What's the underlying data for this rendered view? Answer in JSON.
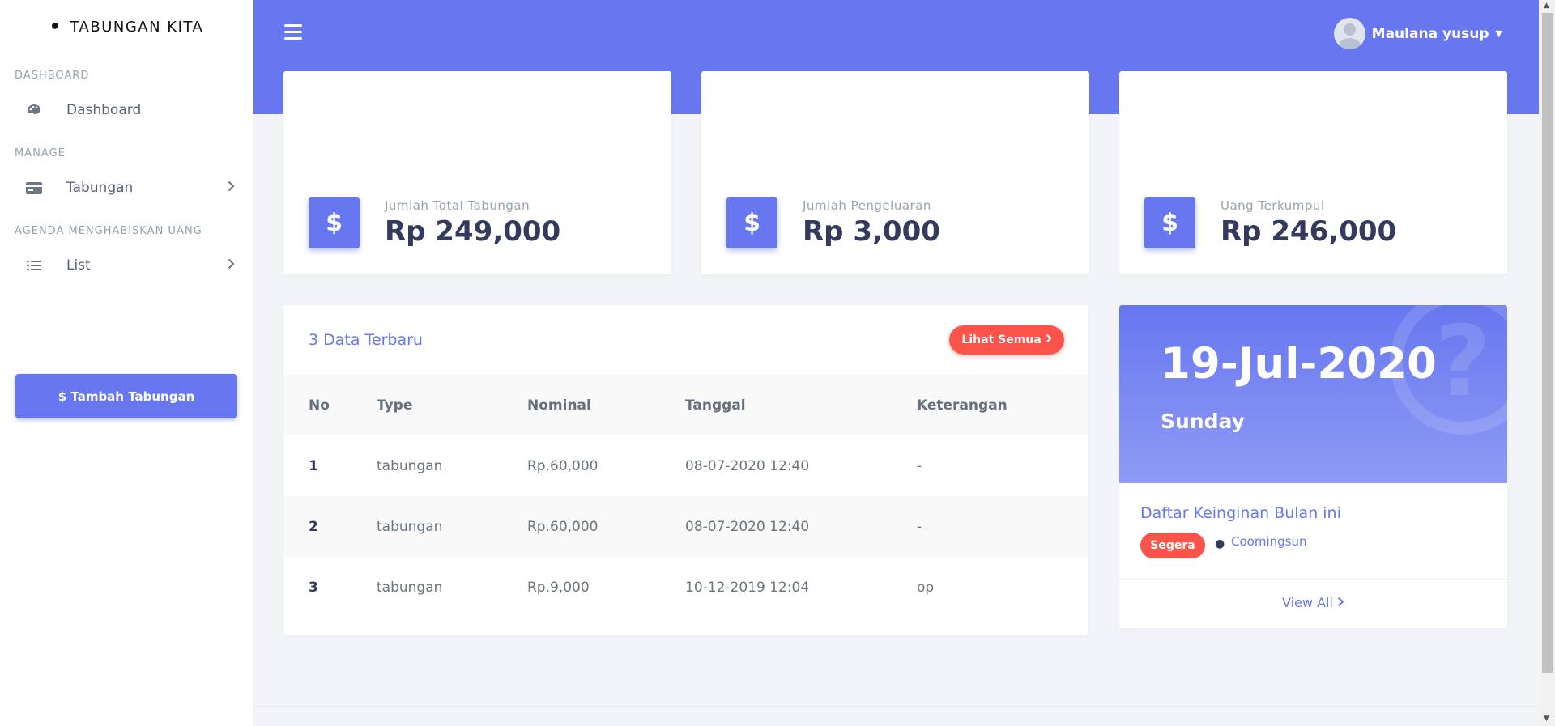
{
  "sidebar": {
    "brand": "TABUNGAN KITA",
    "sections": [
      {
        "title": "DASHBOARD",
        "items": [
          {
            "label": "Dashboard",
            "icon": "palette-icon",
            "chevron": false
          }
        ]
      },
      {
        "title": "MANAGE",
        "items": [
          {
            "label": "Tabungan",
            "icon": "credit-card-icon",
            "chevron": true
          }
        ]
      },
      {
        "title": "AGENDA MENGHABISKAN UANG",
        "items": [
          {
            "label": "List",
            "icon": "list-icon",
            "chevron": true
          }
        ]
      }
    ],
    "add_button": "$ Tambah Tabungan"
  },
  "header": {
    "user_name": "Maulana yusup"
  },
  "stats": [
    {
      "label": "Jumlah Total Tabungan",
      "value": "Rp 249,000"
    },
    {
      "label": "Jumlah Pengeluaran",
      "value": "Rp 3,000"
    },
    {
      "label": "Uang Terkumpul",
      "value": "Rp 246,000"
    }
  ],
  "latest": {
    "title": "3 Data Terbaru",
    "button": "Lihat Semua",
    "columns": [
      "No",
      "Type",
      "Nominal",
      "Tanggal",
      "Keterangan"
    ],
    "rows": [
      [
        "1",
        "tabungan",
        "Rp.60,000",
        "08-07-2020 12:40",
        "-"
      ],
      [
        "2",
        "tabungan",
        "Rp.60,000",
        "08-07-2020 12:40",
        "-"
      ],
      [
        "3",
        "tabungan",
        "Rp.9,000",
        "10-12-2019 12:04",
        "op"
      ]
    ]
  },
  "datecard": {
    "date": "19-Jul-2020",
    "day": "Sunday",
    "title": "Daftar Keinginan Bulan ini",
    "badge": "Segera",
    "item": "Coomingsun",
    "view_all": "View All"
  },
  "colors": {
    "primary": "#6777ef",
    "danger": "#fc544b"
  }
}
